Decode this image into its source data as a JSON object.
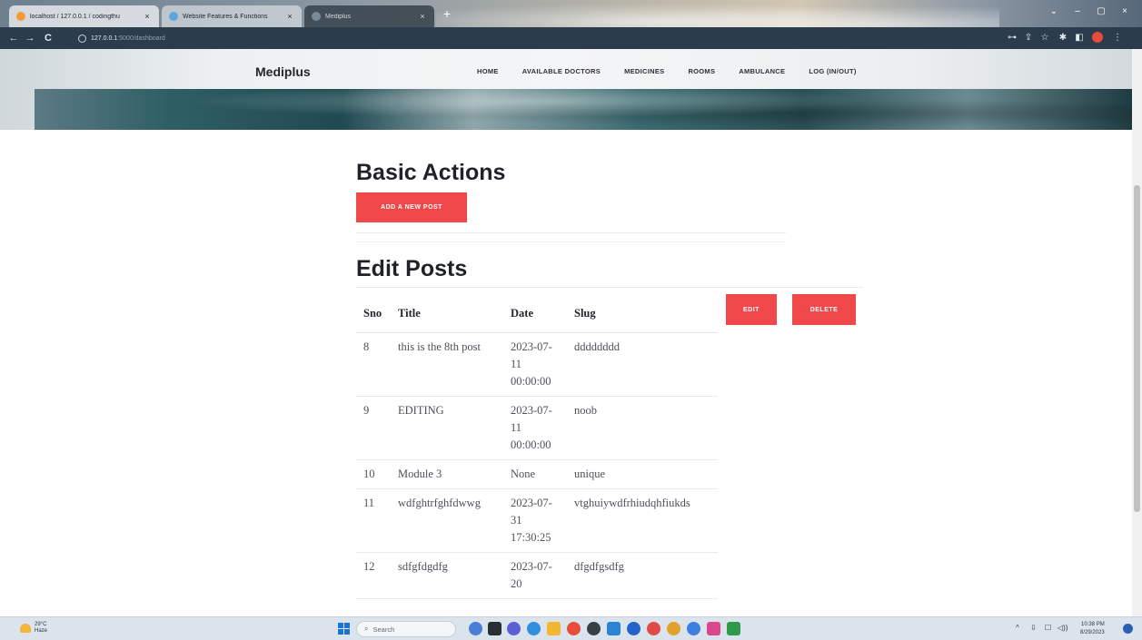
{
  "browser": {
    "tabs": [
      {
        "title": "localhost / 127.0.0.1 / codingthu",
        "close": "×"
      },
      {
        "title": "Website Features & Functions",
        "close": "×"
      },
      {
        "title": "Mediplus",
        "close": "×"
      }
    ],
    "new_tab": "+",
    "url_host": "127.0.0.1",
    "url_rest": ":5000/dashboard",
    "window_controls": [
      "⌄",
      "–",
      "▢",
      "×"
    ],
    "nav_icons": [
      "back-icon",
      "forward-icon",
      "reload-icon"
    ],
    "toolbar_icons": [
      "key-icon",
      "share-icon",
      "star-icon",
      "extensions-icon",
      "sidepanel-icon",
      "profile-icon",
      "menu-icon"
    ]
  },
  "site": {
    "brand": "Mediplus",
    "nav": [
      "HOME",
      "AVAILABLE DOCTORS",
      "MEDICINES",
      "ROOMS",
      "AMBULANCE",
      "LOG (IN/OUT)"
    ]
  },
  "dashboard": {
    "basic_actions_title": "Basic Actions",
    "add_post_button": "ADD A NEW POST",
    "edit_posts_title": "Edit Posts",
    "edit_button": "EDIT",
    "delete_button": "DELETE",
    "table": {
      "headers": [
        "Sno",
        "Title",
        "Date",
        "Slug"
      ],
      "rows": [
        {
          "sno": "8",
          "title": "this is the 8th post",
          "date": "2023-07-11 00:00:00",
          "slug": "dddddddd"
        },
        {
          "sno": "9",
          "title": "EDITING",
          "date": "2023-07-11 00:00:00",
          "slug": "noob"
        },
        {
          "sno": "10",
          "title": "Module 3",
          "date": "None",
          "slug": "unique"
        },
        {
          "sno": "11",
          "title": "wdfghtrfghfdwwg",
          "date": "2023-07-31 17:30:25",
          "slug": "vtghuiywdfrhiudqhfiukds"
        },
        {
          "sno": "12",
          "title": "sdfgfdgdfg",
          "date": "2023-07-20",
          "slug": "dfgdfgsdfg"
        }
      ]
    }
  },
  "taskbar": {
    "weather_temp": "29°C",
    "weather_desc": "Haze",
    "search_placeholder": "Search",
    "time": "10:38 PM",
    "date": "8/29/2023",
    "tray_icons": [
      "^",
      "⇩",
      "☐",
      "◁))"
    ]
  },
  "colors": {
    "accent": "#f0474b",
    "addressbar": "#2b3c4d",
    "taskbar": "#dbe3ec"
  }
}
